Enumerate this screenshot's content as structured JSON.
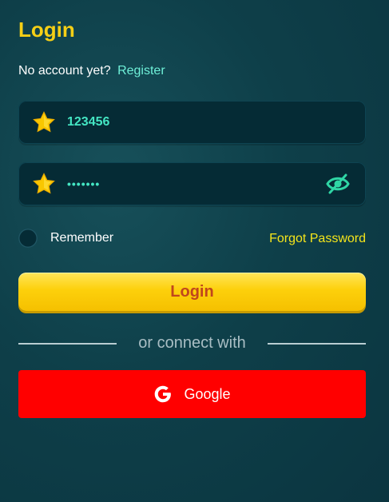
{
  "header": {
    "title": "Login"
  },
  "account_prompt": {
    "text": "No account yet?",
    "register_link": "Register"
  },
  "form": {
    "username": {
      "value": "123456",
      "icon": "star-icon"
    },
    "password": {
      "value": "•••••••",
      "icon": "star-icon",
      "toggle_icon": "eye-off-icon"
    },
    "remember_label": "Remember",
    "remember_checked": false,
    "forgot_password": "Forgot Password",
    "submit_label": "Login"
  },
  "divider": {
    "text": "or connect with"
  },
  "social": {
    "google_label": "Google",
    "google_icon": "google-g-icon"
  },
  "colors": {
    "accent_yellow": "#f5cf16",
    "link_teal": "#6ff0d8",
    "value_teal": "#44e6c3",
    "google_red": "#ff0000",
    "button_text": "#c0461d",
    "background": "#0e3f49"
  }
}
